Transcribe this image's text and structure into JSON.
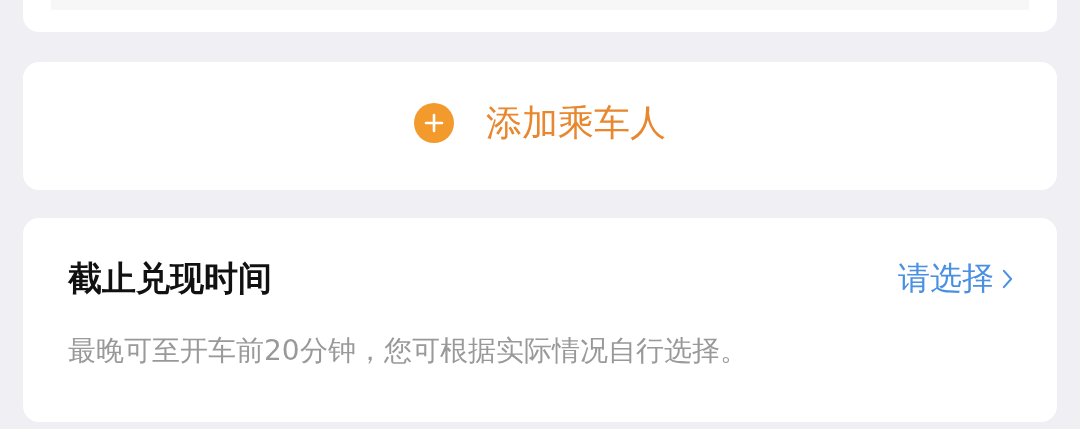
{
  "add_passenger": {
    "label": "添加乘车人"
  },
  "deadline": {
    "title": "截止兑现时间",
    "value": "请选择",
    "note": "最晚可至开车前20分钟，您可根据实际情况自行选择。"
  }
}
